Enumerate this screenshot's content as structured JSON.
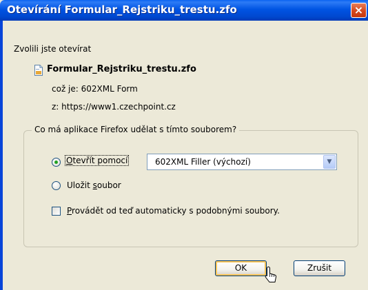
{
  "window": {
    "title": "Otevírání Formular_Rejstriku_trestu.zfo",
    "close_glyph": "×"
  },
  "dialog": {
    "lead_text": "Zvolili jste otevírat",
    "file_icon": "document-icon",
    "filename": "Formular_Rejstriku_trestu.zfo",
    "type_line": "což je:  602XML Form",
    "source_line": "z:  https://www1.czechpoint.cz",
    "group_title": "Co má aplikace Firefox udělat s tímto souborem?",
    "open_with": {
      "label_mnemonic": "O",
      "label_rest": "tevřít pomocí",
      "checked": true,
      "selected_app": "602XML Filler (výchozí)"
    },
    "save_file": {
      "label_start": "Uložit ",
      "label_mnemonic": "s",
      "label_rest": "oubor",
      "checked": false
    },
    "auto_checkbox": {
      "label_mnemonic": "P",
      "label_rest": "rovádět od teď automaticky s podobnými soubory.",
      "checked": false
    },
    "buttons": {
      "ok": "OK",
      "cancel": "Zrušit"
    }
  },
  "colors": {
    "titlebar": "#0054e3",
    "window_bg": "#ece9d8",
    "close_button": "#d6481d",
    "radio_dot": "#21a121"
  }
}
